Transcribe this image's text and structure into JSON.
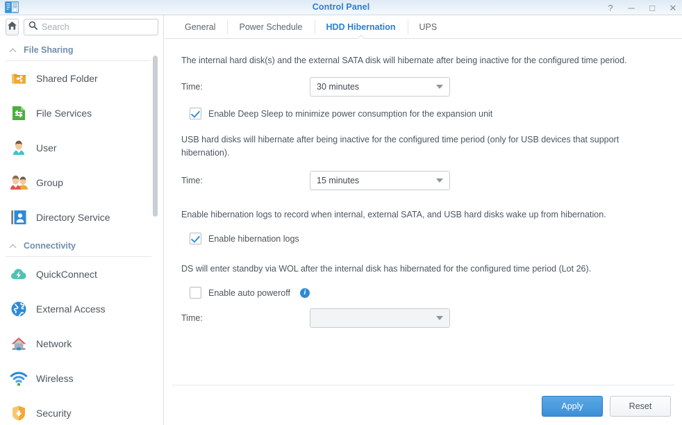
{
  "window": {
    "title": "Control Panel",
    "icon": "control-panel-icon",
    "controls": [
      {
        "name": "help-button",
        "glyph": "?"
      },
      {
        "name": "minimize-button",
        "glyph": "─"
      },
      {
        "name": "maximize-button",
        "glyph": "□"
      },
      {
        "name": "close-button",
        "glyph": "✕"
      }
    ]
  },
  "sidebar": {
    "home_button": "home-icon",
    "search": {
      "placeholder": "Search",
      "value": "",
      "icon": "search-icon"
    },
    "groups": [
      {
        "label": "File Sharing",
        "expanded": true,
        "items": [
          {
            "label": "Shared Folder",
            "icon": "shared-folder-icon"
          },
          {
            "label": "File Services",
            "icon": "file-services-icon"
          },
          {
            "label": "User",
            "icon": "user-icon"
          },
          {
            "label": "Group",
            "icon": "group-icon"
          },
          {
            "label": "Directory Service",
            "icon": "directory-service-icon"
          }
        ]
      },
      {
        "label": "Connectivity",
        "expanded": true,
        "items": [
          {
            "label": "QuickConnect",
            "icon": "quickconnect-icon"
          },
          {
            "label": "External Access",
            "icon": "external-access-icon"
          },
          {
            "label": "Network",
            "icon": "network-icon"
          },
          {
            "label": "Wireless",
            "icon": "wireless-icon"
          },
          {
            "label": "Security",
            "icon": "security-icon"
          }
        ]
      }
    ]
  },
  "tabs": [
    {
      "label": "General",
      "active": false
    },
    {
      "label": "Power Schedule",
      "active": false
    },
    {
      "label": "HDD Hibernation",
      "active": true
    },
    {
      "label": "UPS",
      "active": false
    }
  ],
  "panel": {
    "internal_desc": "The internal hard disk(s) and the external SATA disk will hibernate after being inactive for the configured time period.",
    "internal_time_label": "Time:",
    "internal_time_value": "30 minutes",
    "deep_sleep_label": "Enable Deep Sleep to minimize power consumption for the expansion unit",
    "deep_sleep_checked": true,
    "usb_desc": "USB hard disks will hibernate after being inactive for the configured time period (only for USB devices that support hibernation).",
    "usb_time_label": "Time:",
    "usb_time_value": "15 minutes",
    "logs_desc": "Enable hibernation logs to record when internal, external SATA, and USB hard disks wake up from hibernation.",
    "logs_label": "Enable hibernation logs",
    "logs_checked": true,
    "wol_desc": "DS will enter standby via WOL after the internal disk has hibernated for the configured time period (Lot 26).",
    "poweroff_label": "Enable auto poweroff",
    "poweroff_checked": false,
    "poweroff_info_icon": "info-icon",
    "poweroff_time_label": "Time:",
    "poweroff_time_value": ""
  },
  "footer": {
    "apply_label": "Apply",
    "reset_label": "Reset"
  },
  "colors": {
    "accent": "#2b7ed1",
    "title_text": "#2b7ed1",
    "group_label": "#6f8fad",
    "body_text": "#4c555e",
    "primary_button": "#3d8ed6"
  }
}
